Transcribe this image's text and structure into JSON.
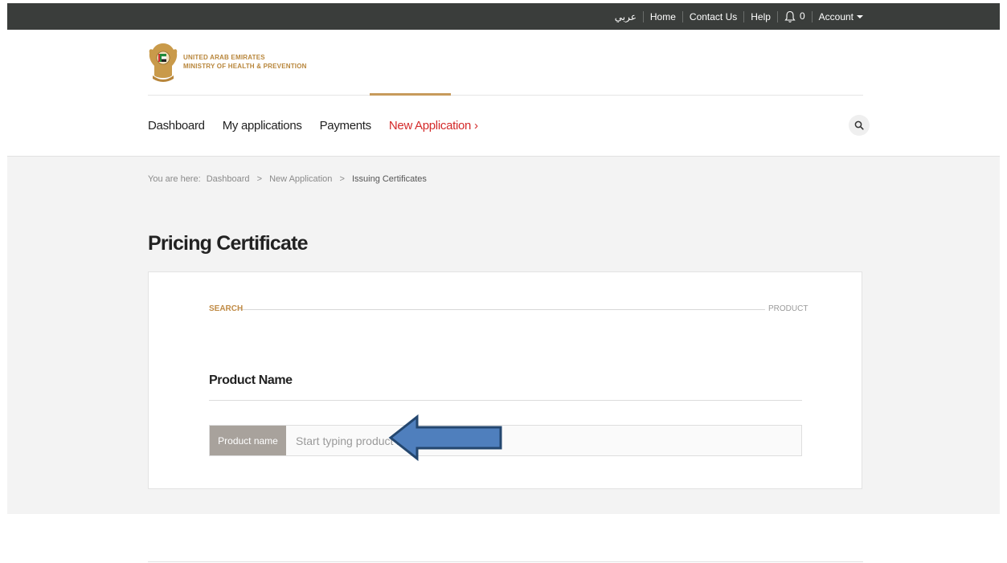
{
  "topbar": {
    "lang_label": "عربي",
    "home_label": "Home",
    "contact_label": "Contact Us",
    "help_label": "Help",
    "notification_count": "0",
    "account_label": "Account"
  },
  "logo": {
    "line1": "UNITED ARAB EMIRATES",
    "line2": "MINISTRY OF HEALTH & PREVENTION"
  },
  "mainnav": {
    "items": [
      {
        "label": "Dashboard"
      },
      {
        "label": "My applications"
      },
      {
        "label": "Payments"
      },
      {
        "label": "New Application ›"
      }
    ]
  },
  "breadcrumb": {
    "prefix": "You are here:",
    "items": [
      {
        "label": "Dashboard"
      },
      {
        "label": "New Application"
      },
      {
        "label": "Issuing Certificates"
      }
    ],
    "separator": ">"
  },
  "page": {
    "title": "Pricing Certificate"
  },
  "steps": {
    "current": "SEARCH",
    "next": "PRODUCT"
  },
  "form": {
    "section_title": "Product Name",
    "field_label": "Product name",
    "field_placeholder": "Start typing product name",
    "field_value": ""
  },
  "colors": {
    "topbar": "#3a3d3b",
    "accent_gold": "#c79a5b",
    "active_red": "#d42a2a",
    "arrow_blue": "#4f7fbd"
  },
  "icons": {
    "bell": "bell-icon",
    "search": "search-icon",
    "caret": "chevron-down-icon",
    "arrow": "arrow-left-icon"
  }
}
